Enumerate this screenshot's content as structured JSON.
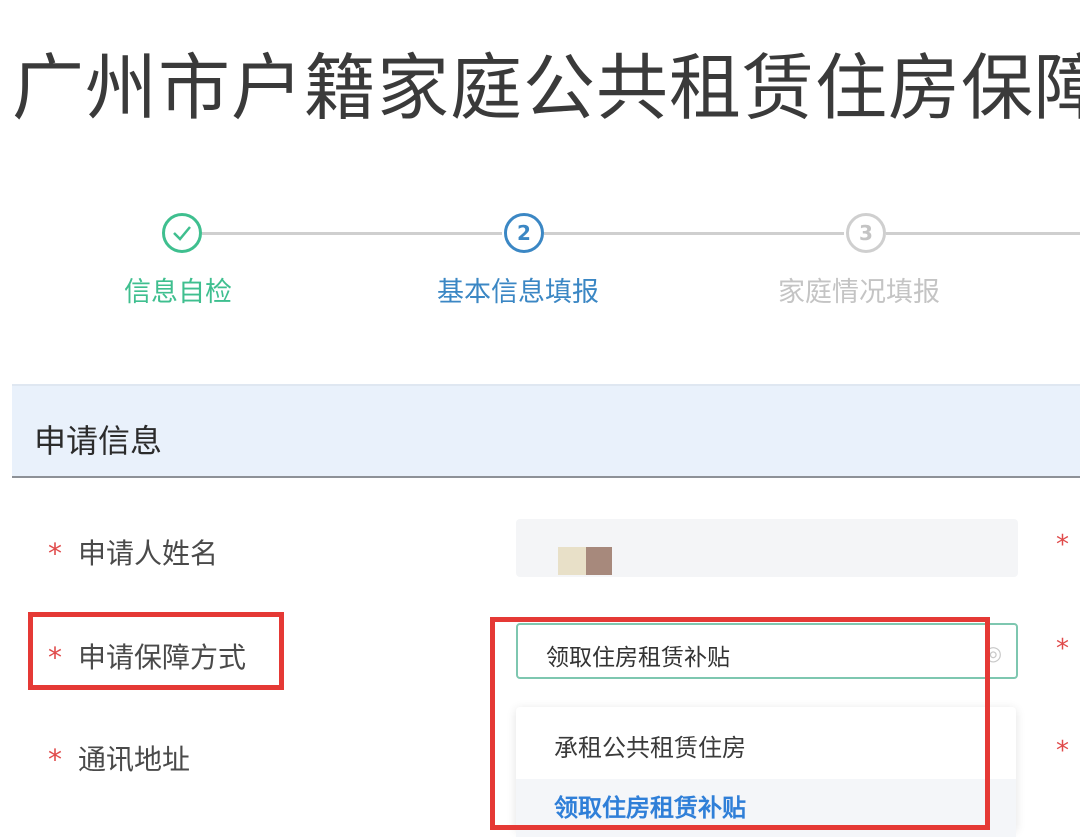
{
  "page": {
    "title": "广州市户籍家庭公共租赁住房保障"
  },
  "steps": [
    {
      "number": "",
      "label": "信息自检",
      "state": "done",
      "color": "#3fbf8f"
    },
    {
      "number": "2",
      "label": "基本信息填报",
      "state": "active",
      "color": "#3b87c4"
    },
    {
      "number": "3",
      "label": "家庭情况填报",
      "state": "pending",
      "color": "#c4c4c4"
    }
  ],
  "panel": {
    "title": "申请信息"
  },
  "form": {
    "required_mark": "*",
    "applicant_name": {
      "label": "申请人姓名"
    },
    "guarantee_method": {
      "label": "申请保障方式",
      "value": "领取住房租赁补贴",
      "options": [
        "承租公共租赁住房",
        "领取住房租赁补贴"
      ]
    },
    "address": {
      "label": "通讯地址"
    }
  },
  "colors": {
    "highlight_box": "#e53935",
    "active_option": "#2f7fd8",
    "select_border": "#7ec7b0"
  }
}
